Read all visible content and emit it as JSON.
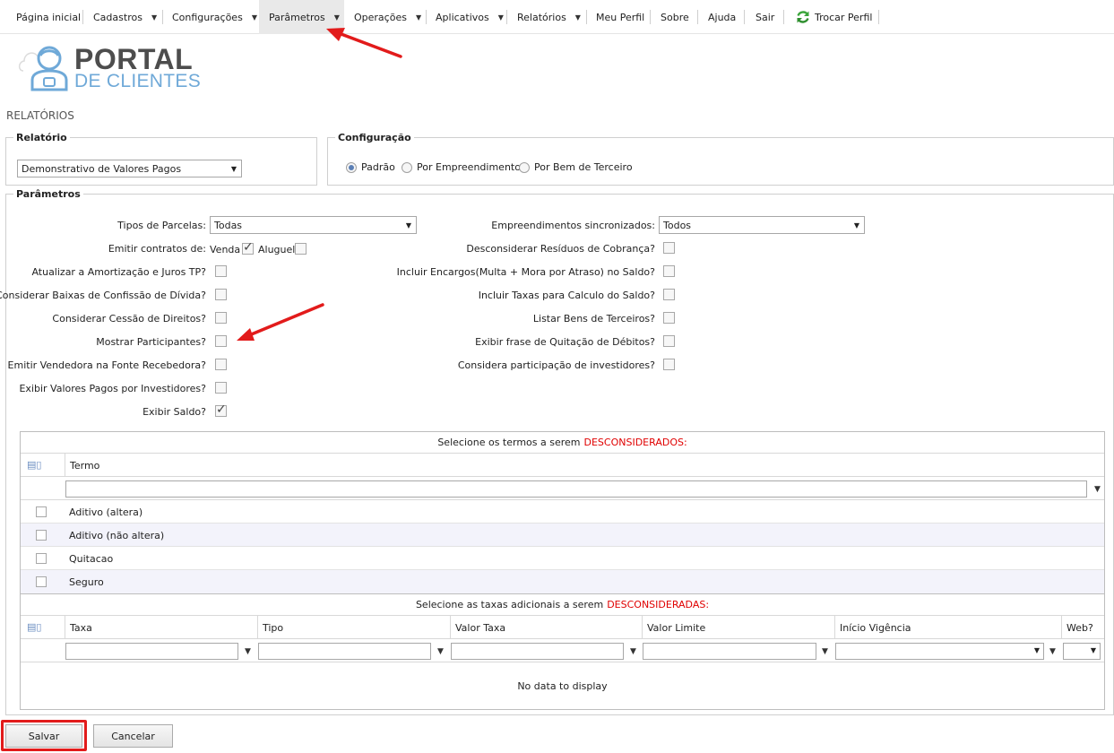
{
  "menu": {
    "items": [
      "Página inicial",
      "Cadastros",
      "Configurações",
      "Parâmetros",
      "Operações",
      "Aplicativos",
      "Relatórios",
      "Meu Perfil",
      "Sobre",
      "Ajuda",
      "Sair"
    ],
    "switch_profile": "Trocar Perfil"
  },
  "logo": {
    "line1": "PORTAL",
    "line2": "DE CLIENTES"
  },
  "page_title": "RELATÓRIOS",
  "report": {
    "legend": "Relatório",
    "selected": "Demonstrativo de Valores Pagos"
  },
  "config": {
    "legend": "Configuração",
    "options": [
      "Padrão",
      "Por Empreendimento",
      "Por Bem de Terceiro"
    ],
    "selected": "Padrão"
  },
  "params": {
    "legend": "Parâmetros",
    "tipos_parcelas_label": "Tipos de Parcelas:",
    "tipos_parcelas_value": "Todas",
    "emitir_contratos_label": "Emitir contratos de:",
    "venda_label": "Venda",
    "aluguel_label": "Aluguel",
    "left": [
      {
        "label": "Atualizar a Amortização e Juros TP?",
        "checked": false
      },
      {
        "label": "Considerar Baixas de Confissão de Dívida?",
        "checked": false
      },
      {
        "label": "Considerar Cessão de Direitos?",
        "checked": false
      },
      {
        "label": "Mostrar Participantes?",
        "checked": false
      },
      {
        "label": "Emitir Vendedora na Fonte Recebedora?",
        "checked": false
      },
      {
        "label": "Exibir Valores Pagos por Investidores?",
        "checked": false
      },
      {
        "label": "Exibir Saldo?",
        "checked": true
      }
    ],
    "empreendimentos_label": "Empreendimentos sincronizados:",
    "empreendimentos_value": "Todos",
    "right": [
      {
        "label": "Desconsiderar Resíduos de Cobrança?",
        "checked": false
      },
      {
        "label": "Incluir Encargos(Multa + Mora por Atraso) no Saldo?",
        "checked": false
      },
      {
        "label": "Incluir Taxas para Calculo do Saldo?",
        "checked": false
      },
      {
        "label": "Listar Bens de Terceiros?",
        "checked": false
      },
      {
        "label": "Exibir frase de Quitação de Débitos?",
        "checked": false
      },
      {
        "label": "Considera participação de investidores?",
        "checked": false
      }
    ]
  },
  "terms_grid": {
    "title": "Selecione os termos a serem",
    "title_red": "DESCONSIDERADOS:",
    "column": "Termo",
    "rows": [
      "Aditivo (altera)",
      "Aditivo (não altera)",
      "Quitacao",
      "Seguro"
    ]
  },
  "taxes_grid": {
    "title": "Selecione as taxas adicionais a serem",
    "title_red": "DESCONSIDERADAS:",
    "columns": [
      "Taxa",
      "Tipo",
      "Valor Taxa",
      "Valor Limite",
      "Início Vigência",
      "Web?"
    ],
    "empty": "No data to display"
  },
  "buttons": {
    "save": "Salvar",
    "cancel": "Cancelar"
  },
  "colors": {
    "annotation": "#e21b1b",
    "accent": "#6fa9d8",
    "required": "#e00000"
  }
}
